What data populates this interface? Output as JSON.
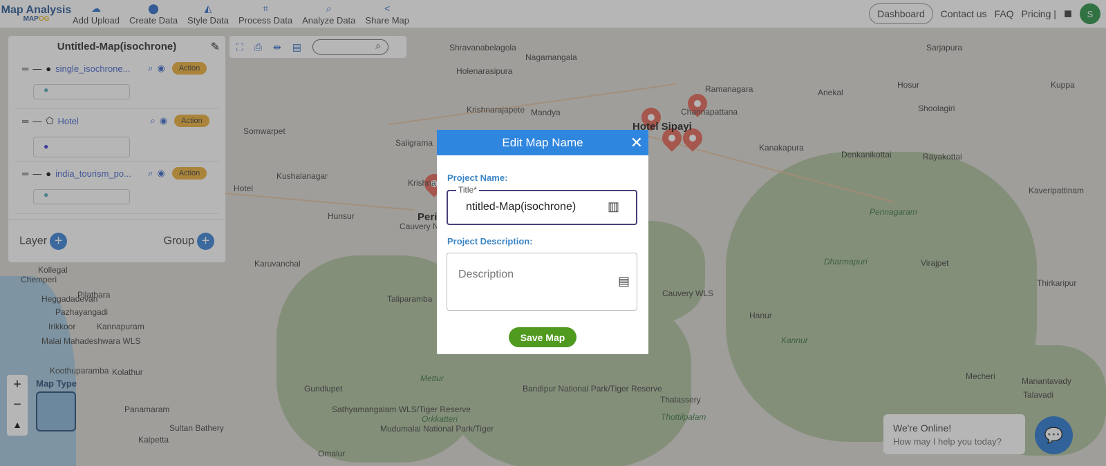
{
  "header": {
    "logo_title": "Map Analysis",
    "logo_sub_a": "MAP",
    "logo_sub_b": "OG",
    "nav": [
      {
        "label": "Add Upload",
        "icon": "cloud-upload-icon"
      },
      {
        "label": "Create Data",
        "icon": "map-pin-icon"
      },
      {
        "label": "Style Data",
        "icon": "paint-bucket-icon"
      },
      {
        "label": "Process Data",
        "icon": "process-icon"
      },
      {
        "label": "Analyze Data",
        "icon": "analyze-icon"
      },
      {
        "label": "Share Map",
        "icon": "share-icon"
      }
    ],
    "dashboard": "Dashboard",
    "contact": "Contact us",
    "faq": "FAQ",
    "pricing": "Pricing |",
    "avatar": "S"
  },
  "panel": {
    "title": "Untitled-Map(isochrone)",
    "layers": [
      {
        "name": "single_isochrone...",
        "action": "Action"
      },
      {
        "name": "Hotel",
        "action": "Action"
      },
      {
        "name": "india_tourism_po...",
        "action": "Action"
      }
    ],
    "layer_label": "Layer",
    "group_label": "Group"
  },
  "map": {
    "type_label": "Map Type",
    "labels": [
      "Shravanabelagola",
      "Nagamangala",
      "Sarjapura",
      "Holenarasipura",
      "Ramanagara",
      "Anekal",
      "Hosur",
      "Kuppa",
      "Krishnarajapete",
      "Mandya",
      "Channapattana",
      "Shoolagiri",
      "Somwarpet",
      "Hotel Sipayi",
      "Saligrama",
      "Kanakapura",
      "Denkanikottai",
      "Rayakottai",
      "Kushalanagar",
      "Krishna",
      "Kaveripattinam",
      "Hotel",
      "Periyapatna",
      "Hunsur",
      "Cauvery North WLS",
      "Pennagaram",
      "Virajpet",
      "Karuvanchal",
      "Kollegal",
      "Cauvery WLS",
      "Dharmapuri",
      "Thirkaripur",
      "Chemperi",
      "Pilathara",
      "Heggadadevan",
      "Taliparamba",
      "Hanur",
      "Pazhayangadi",
      "Irikkoor",
      "Kannapuram",
      "Malai Mahadeshwara WLS",
      "Kannur",
      "Koothuparamba",
      "Kolathur",
      "Mecheri",
      "Manantavady",
      "Gundlupet",
      "Bandipur National Park/Tiger Reserve",
      "Mettur",
      "Talavadi",
      "Thalassery",
      "Panamaram",
      "Sathyamangalam WLS/Tiger Reserve",
      "Thottilpalam",
      "Sultan Bathery",
      "Mudumalai National Park/Tiger",
      "Orkkatteri",
      "Kalpetta",
      "Omalur"
    ]
  },
  "modal": {
    "title": "Edit Map Name",
    "project_name_label": "Project Name:",
    "title_legend": "Title*",
    "title_value": "ntitled-Map(isochrone)",
    "desc_label": "Project Description:",
    "desc_placeholder": "Description",
    "save": "Save Map"
  },
  "chat": {
    "title": "We're Online!",
    "subtitle": "How may I help you today?"
  },
  "colors": {
    "accent": "#2f86de",
    "save": "#4f9a1f",
    "action": "#e9a92a",
    "avatar": "#1b8a3a"
  }
}
